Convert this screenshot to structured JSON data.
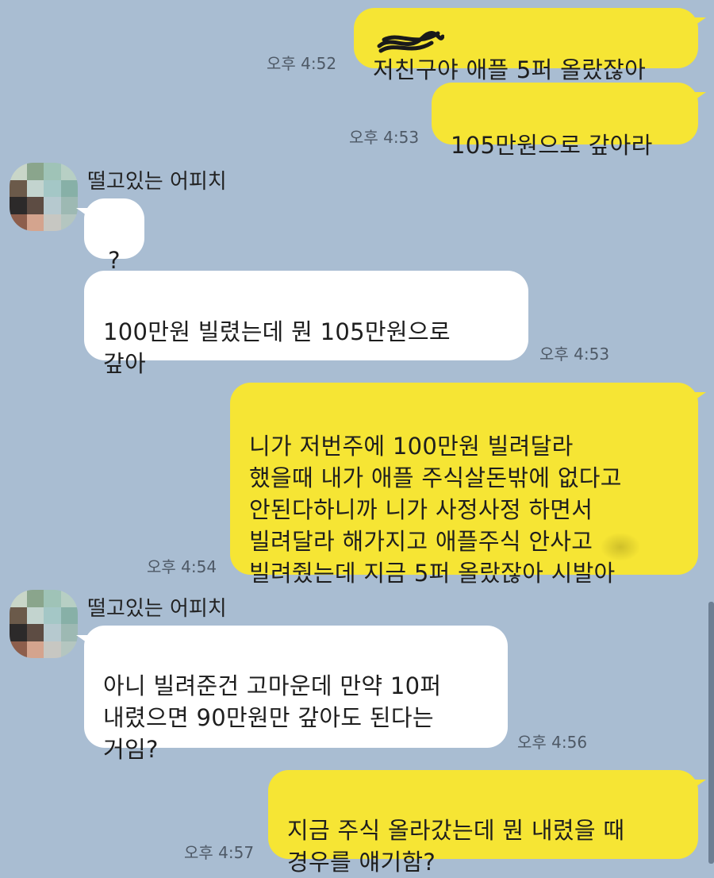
{
  "messages": [
    {
      "side": "me",
      "text": "저친구야 애플 5퍼 올랐잖아",
      "time": "오후 4:52"
    },
    {
      "side": "me",
      "text": "105만원으로 갚아라",
      "time": "오후 4:53"
    },
    {
      "side": "them",
      "sender": "떨고있는 어피치",
      "text": "?",
      "time": ""
    },
    {
      "side": "them",
      "text": "100만원 빌렸는데 뭔 105만원으로\n갚아",
      "time": "오후 4:53"
    },
    {
      "side": "me",
      "text": "니가 저번주에 100만원 빌려달라\n했을때 내가 애플 주식살돈밖에 없다고\n안된다하니까 니가 사정사정 하면서\n빌려달라 해가지고 애플주식 안사고\n빌려줬는데 지금 5퍼 올랐잖아 시발아",
      "time": "오후 4:54"
    },
    {
      "side": "them",
      "sender": "떨고있는 어피치",
      "text": "아니 빌려준건 고마운데 만약 10퍼\n내렸으면 90만원만 갚아도 된다는\n거임?",
      "time": "오후 4:56"
    },
    {
      "side": "me",
      "text": "지금 주식 올라갔는데 뭔 내렸을 때\n경우를 얘기함?",
      "time": "오후 4:57"
    }
  ],
  "colors": {
    "background": "#a9bdd2",
    "my_bubble": "#f6e534",
    "their_bubble": "#ffffff"
  },
  "icons": {
    "avatar": "pixelated-avatar-icon"
  }
}
